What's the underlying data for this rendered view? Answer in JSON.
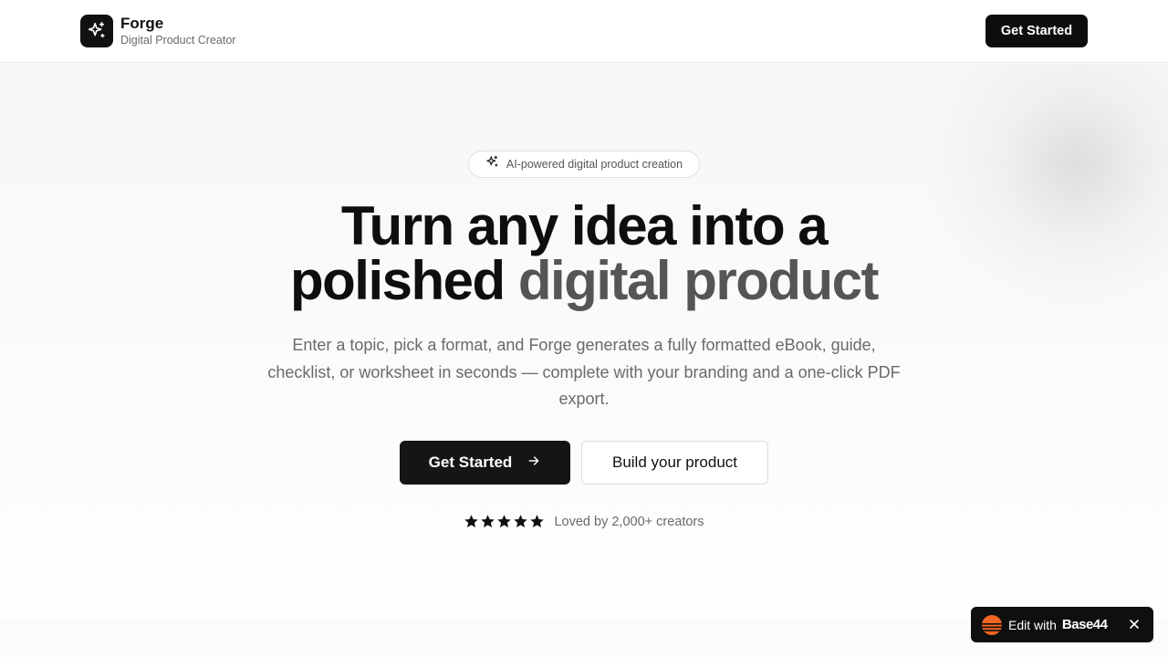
{
  "nav": {
    "brand_name": "Forge",
    "brand_tagline": "Digital Product Creator",
    "cta_label": "Get Started"
  },
  "hero": {
    "pill_text": "AI-powered digital product creation",
    "headline_line1": "Turn any idea into a",
    "headline_line2_dark": "polished",
    "headline_line2_muted": "digital product",
    "subtitle": "Enter a topic, pick a format, and Forge generates a fully formatted eBook, guide, checklist, or worksheet in seconds — complete with your branding and a one-click PDF export.",
    "primary_cta": "Get Started",
    "secondary_cta": "Build your product",
    "rating_stars": 5,
    "rating_text": "Loved by 2,000+ creators"
  },
  "badge": {
    "prefix": "Edit with",
    "brand": "Base44"
  },
  "icons": {
    "brand_logo": "sparkles-icon",
    "pill_icon": "sparkles-icon",
    "cta_arrow": "arrow-right-icon",
    "star": "star-icon",
    "badge_logo": "base44-logo-icon",
    "badge_close": "close-icon"
  },
  "colors": {
    "primary": "#111111",
    "muted_heading": "#555555",
    "badge_accent": "#f26522"
  }
}
